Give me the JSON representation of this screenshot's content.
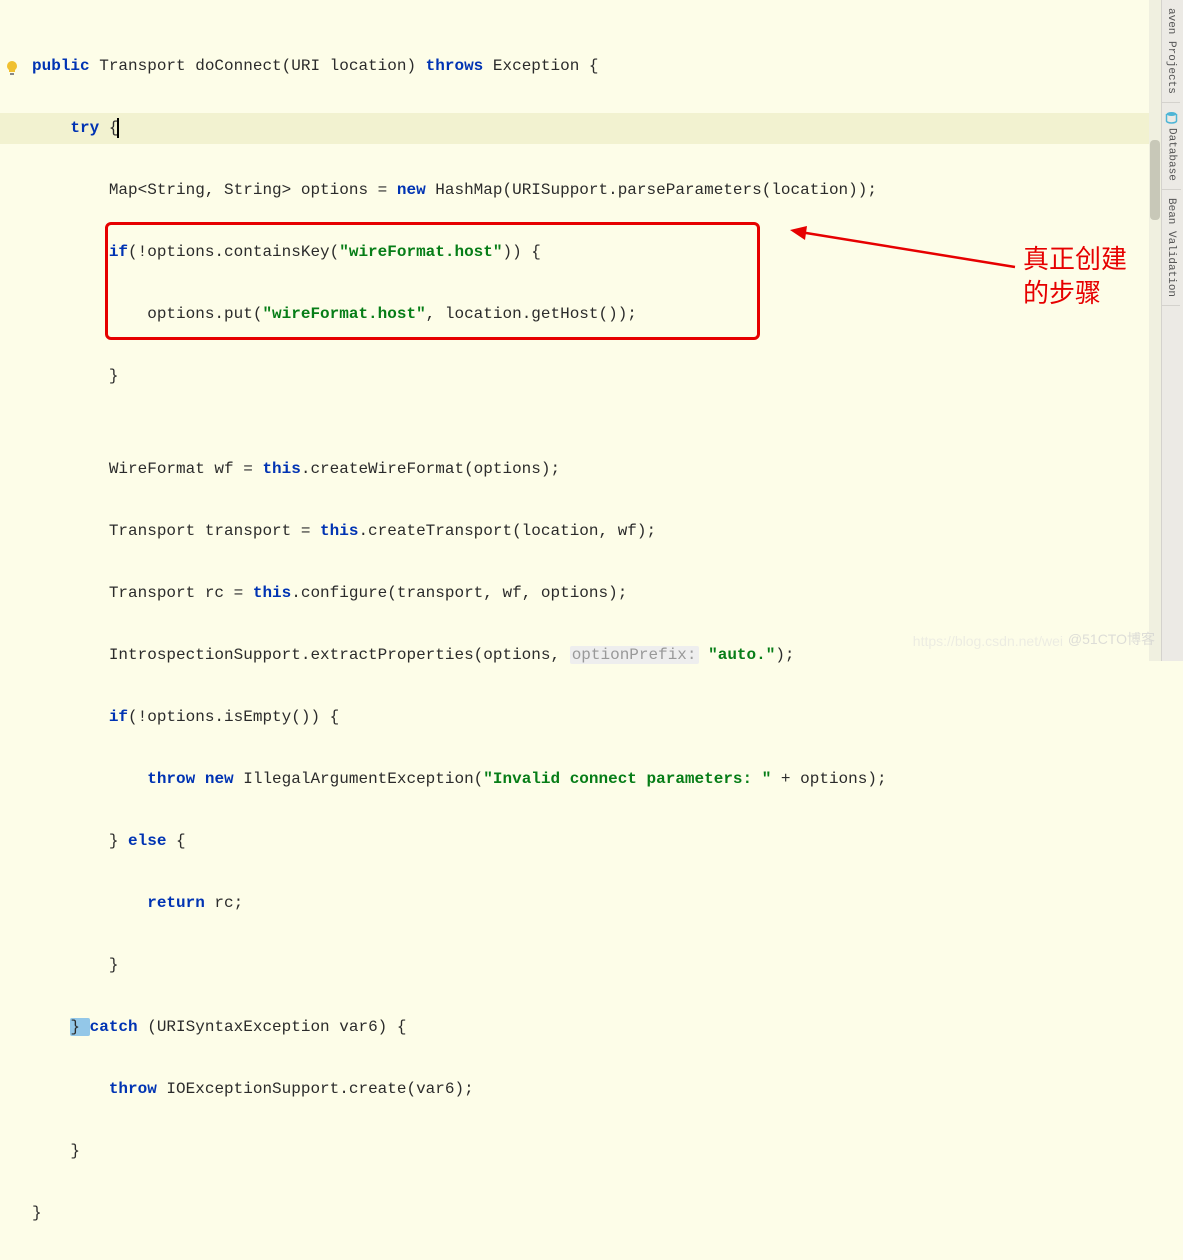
{
  "code": {
    "line1": {
      "kw1": "public",
      "t1": " Transport doConnect(URI location) ",
      "kw2": "throws",
      "t2": " Exception {"
    },
    "line2": {
      "kw1": "try",
      "t1": " {"
    },
    "line3": {
      "t1": "Map<String, String> options = ",
      "kw1": "new",
      "t2": " HashMap(URISupport.parseParameters(location));"
    },
    "line4": {
      "kw1": "if",
      "t1": "(!options.containsKey(",
      "str1": "\"wireFormat.host\"",
      "t2": ")) {"
    },
    "line5": {
      "t1": "options.put(",
      "str1": "\"wireFormat.host\"",
      "t2": ", location.getHost());"
    },
    "line6": {
      "t1": "}"
    },
    "line7": {
      "t1": ""
    },
    "line8": {
      "t1": "WireFormat wf = ",
      "kw1": "this",
      "t2": ".createWireFormat(options);"
    },
    "line9": {
      "t1": "Transport transport = ",
      "kw1": "this",
      "t2": ".createTransport(location, wf);"
    },
    "line10": {
      "t1": "Transport rc = ",
      "kw1": "this",
      "t2": ".configure(transport, wf, options);"
    },
    "line11": {
      "t1": "IntrospectionSupport.extractProperties(options, ",
      "hint": "optionPrefix:",
      "str1": " \"auto.\"",
      "t2": ");"
    },
    "line12": {
      "kw1": "if",
      "t1": "(!options.isEmpty()) {"
    },
    "line13": {
      "kw1": "throw",
      "kw2": " new",
      "t1": " IllegalArgumentException(",
      "str1": "\"Invalid connect parameters: \"",
      "t2": " + options);"
    },
    "line14": {
      "t1": "} ",
      "kw1": "else",
      "t2": " {"
    },
    "line15": {
      "kw1": "return",
      "t1": " rc;"
    },
    "line16": {
      "t1": "}"
    },
    "line17": {
      "t1": "} ",
      "kw1": "catch",
      "t2": " (URISyntaxException var6) {"
    },
    "line18": {
      "kw1": "throw",
      "t1": " IOExceptionSupport.create(var6);"
    },
    "line19": {
      "t1": "}"
    },
    "line20": {
      "t1": "}"
    }
  },
  "annotation": {
    "line1": "真正创建",
    "line2": "的步骤"
  },
  "watermark": {
    "w1": "https://blog.csdn.net/wei",
    "w2": "@51CTO博客"
  },
  "toolwindows": {
    "tab1": "aven Projects",
    "tab2": "Database",
    "tab3": "Bean Validation"
  }
}
